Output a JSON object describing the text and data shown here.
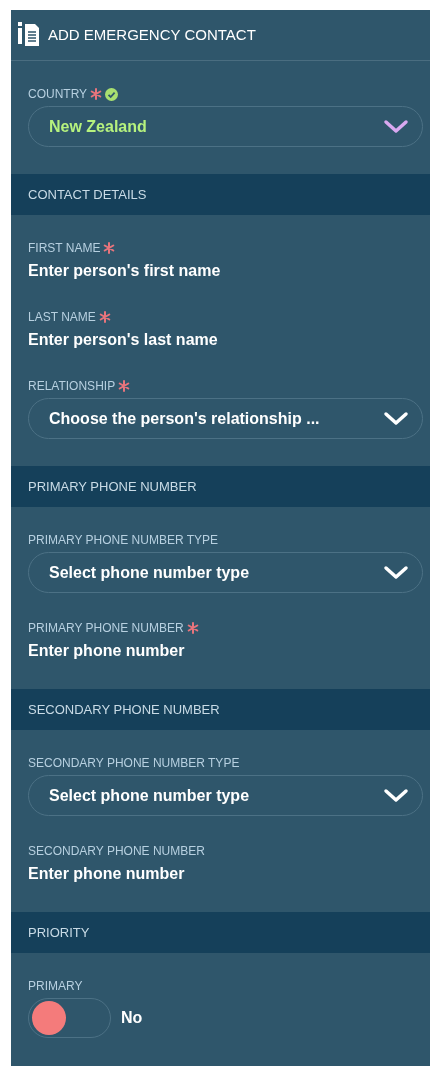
{
  "title": "ADD EMERGENCY CONTACT",
  "sections": [
    {
      "fields": [
        {
          "kind": "select",
          "label": "COUNTRY",
          "required": true,
          "valid": true,
          "value": "New Zealand"
        }
      ]
    },
    {
      "heading": "CONTACT DETAILS",
      "fields": [
        {
          "kind": "text",
          "label": "FIRST NAME",
          "required": true,
          "valid": false,
          "placeholder": "Enter person's first name"
        },
        {
          "kind": "text",
          "label": "LAST NAME",
          "required": true,
          "valid": false,
          "placeholder": "Enter person's last name"
        },
        {
          "kind": "select",
          "label": "RELATIONSHIP",
          "required": true,
          "valid": false,
          "placeholder": "Choose the person's relationship ..."
        }
      ]
    },
    {
      "heading": "PRIMARY PHONE NUMBER",
      "fields": [
        {
          "kind": "select",
          "label": "PRIMARY PHONE NUMBER TYPE",
          "required": false,
          "valid": false,
          "placeholder": "Select phone number type"
        },
        {
          "kind": "text",
          "label": "PRIMARY PHONE NUMBER",
          "required": true,
          "valid": false,
          "placeholder": "Enter phone number"
        }
      ]
    },
    {
      "heading": "SECONDARY PHONE NUMBER",
      "fields": [
        {
          "kind": "select",
          "label": "SECONDARY PHONE NUMBER TYPE",
          "required": false,
          "valid": false,
          "placeholder": "Select phone number type"
        },
        {
          "kind": "text",
          "label": "SECONDARY PHONE NUMBER",
          "required": false,
          "valid": false,
          "placeholder": "Enter phone number"
        }
      ]
    },
    {
      "heading": "PRIORITY",
      "fields": [
        {
          "kind": "toggle",
          "label": "PRIMARY",
          "required": false,
          "valid": false,
          "on": false,
          "state_label": "No"
        }
      ]
    }
  ]
}
